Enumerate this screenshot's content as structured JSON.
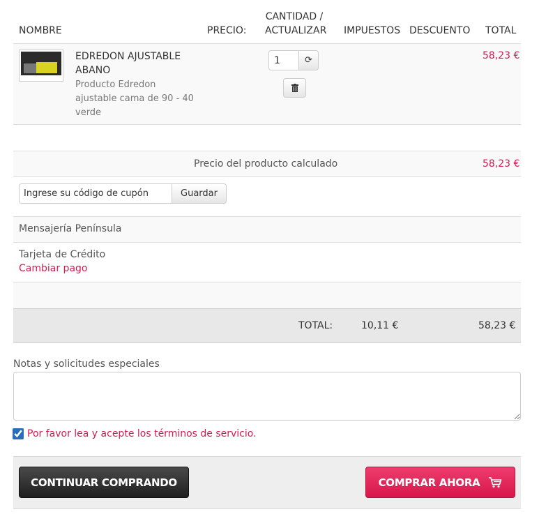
{
  "header": {
    "name": "NOMBRE",
    "price": "PRECIO:",
    "qty_line1": "CANTIDAD /",
    "qty_line2": "ACTUALIZAR",
    "taxes": "IMPUESTOS",
    "discount": "DESCUENTO",
    "total": "TOTAL"
  },
  "product": {
    "title_line1": "EDREDON AJUSTABLE",
    "title_line2": "ABANO",
    "desc_line1": "Producto Edredon",
    "desc_line2": "ajustable cama de 90 - 40",
    "desc_line3": "verde",
    "quantity": "1",
    "total": "58,23 €"
  },
  "subtotal": {
    "label": "Precio del producto calculado",
    "value": "58,23 €"
  },
  "coupon": {
    "placeholder": "Ingrese su código de cupón",
    "button": "Guardar"
  },
  "shipping": {
    "label": "Mensajería Península"
  },
  "payment": {
    "method": "Tarjeta de Crédito",
    "change_link": "Cambiar pago"
  },
  "totals": {
    "label": "TOTAL:",
    "taxes": "10,11 €",
    "total": "58,23 €"
  },
  "notes": {
    "label": "Notas y solicitudes especiales"
  },
  "terms": {
    "label": "Por favor lea y acepte los términos de servicio.",
    "checked": true
  },
  "actions": {
    "continue": "CONTINUAR COMPRANDO",
    "buy": "COMPRAR AHORA"
  },
  "colors": {
    "accent": "#d51b4f",
    "dark_button": "#2b2b2b",
    "band": "#f9f9f9",
    "total_band": "#e8e8e8"
  }
}
